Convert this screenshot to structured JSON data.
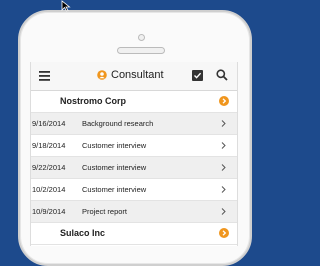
{
  "header": {
    "title": "Consultant",
    "menu_icon": "hamburger-menu-icon",
    "logo_icon": "consultant-logo-icon",
    "check_icon": "checkbox-icon",
    "search_icon": "search-icon"
  },
  "groups": [
    {
      "name": "Nostromo Corp",
      "rows": [
        {
          "date": "9/16/2014",
          "activity": "Background research"
        },
        {
          "date": "9/18/2014",
          "activity": "Customer interview"
        },
        {
          "date": "9/22/2014",
          "activity": "Customer interview"
        },
        {
          "date": "10/2/2014",
          "activity": "Customer interview"
        },
        {
          "date": "10/9/2014",
          "activity": "Project report"
        }
      ]
    },
    {
      "name": "Sulaco Inc",
      "rows": []
    }
  ],
  "colors": {
    "background": "#1d4a8c",
    "accent_orange": "#f0961e",
    "row_alt": "#efefef"
  }
}
